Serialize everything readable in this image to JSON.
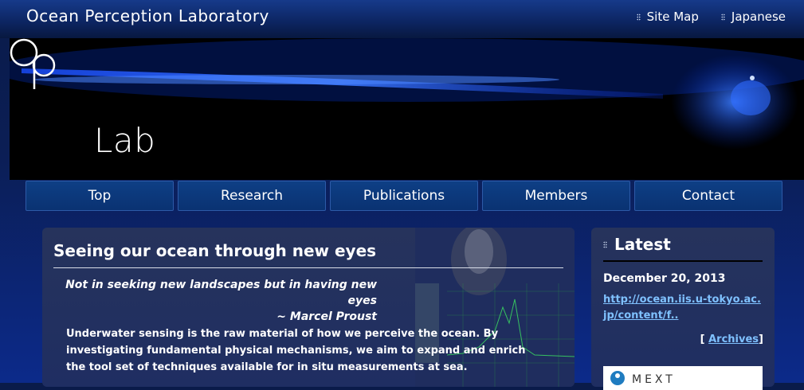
{
  "header": {
    "site_title": "Ocean Perception Laboratory",
    "links": [
      {
        "label": "Site Map"
      },
      {
        "label": "Japanese"
      }
    ]
  },
  "hero": {
    "logo_text": "Lab"
  },
  "nav": {
    "items": [
      {
        "label": "Top"
      },
      {
        "label": "Research"
      },
      {
        "label": "Publications"
      },
      {
        "label": "Members"
      },
      {
        "label": "Contact"
      }
    ]
  },
  "main": {
    "title": "Seeing our ocean through new eyes",
    "quote_line1": "Not in seeking new landscapes but in having new eyes",
    "quote_line2": "~ Marcel Proust",
    "body": "Underwater sensing is the raw material of how we perceive the ocean. By investigating fundamental physical mechanisms, we aim to expand and enrich the tool set of techniques available for in situ measurements at sea."
  },
  "sidebar": {
    "title": "Latest",
    "date": "December 20, 2013",
    "link_text": "http://ocean.iis.u-tokyo.ac.jp/content/f..",
    "archives_open": "[ ",
    "archives_label": "Archives",
    "archives_close": "]",
    "banner_text": "MEXT"
  },
  "colors": {
    "link": "#7fc1ff",
    "nav_bg": "#0e3f85",
    "panel_bg": "#26335c"
  }
}
